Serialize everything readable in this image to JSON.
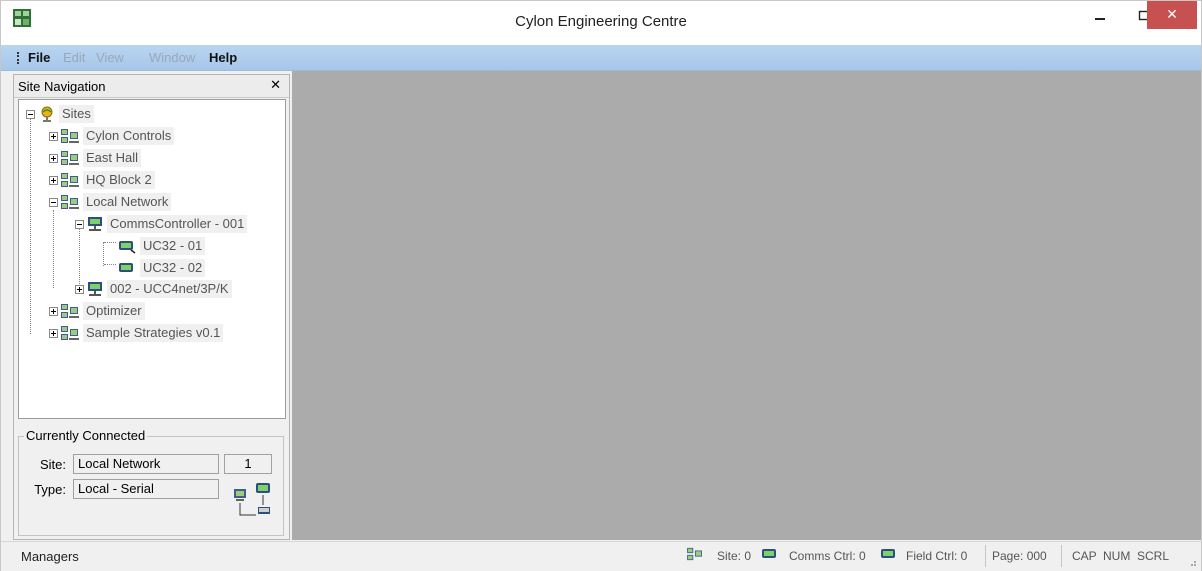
{
  "window": {
    "title": "Cylon Engineering Centre",
    "close_symbol": "✕"
  },
  "menu": [
    {
      "label": "File",
      "enabled": true
    },
    {
      "label": "Edit",
      "enabled": false
    },
    {
      "label": "View",
      "enabled": false
    },
    {
      "label": "Window",
      "enabled": false
    },
    {
      "label": "Help",
      "enabled": true
    }
  ],
  "site_navigation": {
    "title": "Site Navigation",
    "close_symbol": "✕",
    "tree": [
      {
        "label": "Sites",
        "icon": "globe-icon",
        "expanded": true
      },
      {
        "label": "Cylon Controls",
        "icon": "site-network-icon",
        "expanded": false
      },
      {
        "label": "East Hall",
        "icon": "site-network-icon",
        "expanded": false
      },
      {
        "label": "HQ Block 2",
        "icon": "site-network-icon",
        "expanded": false
      },
      {
        "label": "Local Network",
        "icon": "site-network-icon",
        "expanded": true
      },
      {
        "label": "CommsController - 001",
        "icon": "comms-controller-icon",
        "expanded": true
      },
      {
        "label": "UC32 - 01",
        "icon": "field-controller-icon"
      },
      {
        "label": "UC32 - 02",
        "icon": "field-controller-icon"
      },
      {
        "label": "002 - UCC4net/3P/K",
        "icon": "comms-controller-icon",
        "expanded": false
      },
      {
        "label": "Optimizer",
        "icon": "site-network-icon",
        "expanded": false
      },
      {
        "label": "Sample Strategies v0.1",
        "icon": "site-network-icon",
        "expanded": false
      }
    ]
  },
  "currently_connected": {
    "legend": "Currently Connected",
    "site_label": "Site:",
    "site_value": "Local Network",
    "site_number": "1",
    "type_label": "Type:",
    "type_value": "Local - Serial"
  },
  "status_bar": {
    "panel": "Managers",
    "site": "Site: 0",
    "comms": "Comms Ctrl: 0",
    "field": "Field Ctrl: 0",
    "page": "Page: 000",
    "cap": "CAP",
    "num": "NUM",
    "scrl": "SCRL"
  },
  "colors": {
    "menubar": "#a7c7ea",
    "client_area": "#ababab",
    "close_button": "#c75050"
  }
}
